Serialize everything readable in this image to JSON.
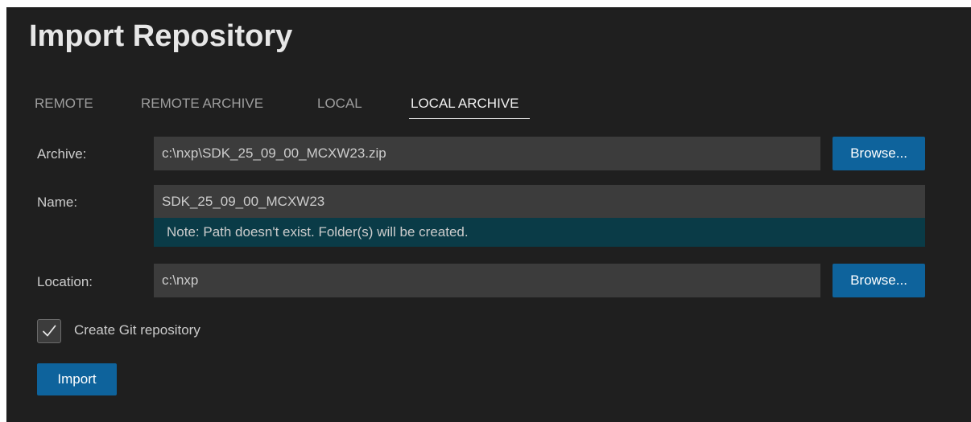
{
  "title": "Import Repository",
  "tabs": [
    {
      "label": "REMOTE",
      "active": false
    },
    {
      "label": "REMOTE ARCHIVE",
      "active": false
    },
    {
      "label": "LOCAL",
      "active": false
    },
    {
      "label": "LOCAL ARCHIVE",
      "active": true
    }
  ],
  "archive": {
    "label": "Archive:",
    "value": "c:\\nxp\\SDK_25_09_00_MCXW23.zip",
    "browse_label": "Browse..."
  },
  "name": {
    "label": "Name:",
    "value": "SDK_25_09_00_MCXW23",
    "note": "Note: Path doesn't exist. Folder(s) will be created."
  },
  "location": {
    "label": "Location:",
    "value": "c:\\nxp",
    "browse_label": "Browse..."
  },
  "git": {
    "label": "Create Git repository",
    "checked": true
  },
  "import_label": "Import",
  "colors": {
    "background": "#1f1f1f",
    "input_bg": "#3c3c3c",
    "button": "#0e639c",
    "note_bg": "#0a3b47"
  },
  "icons": {
    "checkmark": "check-icon"
  }
}
